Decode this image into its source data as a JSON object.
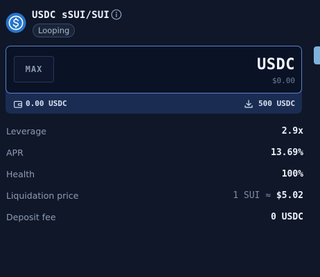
{
  "header": {
    "title": "USDC sSUI/SUI",
    "badge": "Looping",
    "coin_icon": "usdc-coin-icon",
    "info_icon": "info-icon"
  },
  "input": {
    "max_label": "MAX",
    "token": "USDC",
    "fiat_value": "$0.00"
  },
  "balance": {
    "wallet_icon": "wallet-icon",
    "wallet_balance": "0.00 USDC",
    "download_icon": "download-icon",
    "deposit_limit": "500 USDC"
  },
  "stats": [
    {
      "label": "Leverage",
      "value": "2.9x"
    },
    {
      "label": "APR",
      "value": "13.69%"
    },
    {
      "label": "Health",
      "value": "100%"
    },
    {
      "label": "Liquidation price",
      "value_prefix": "1 SUI ≈",
      "value": "$5.02"
    },
    {
      "label": "Deposit fee",
      "value": "0 USDC"
    }
  ],
  "colors": {
    "background": "#0f1729",
    "input_border": "#5b83cc",
    "balance_bar": "#1b2c52",
    "usdc_blue": "#2775ca",
    "accent_handle": "#7fb2dc"
  }
}
